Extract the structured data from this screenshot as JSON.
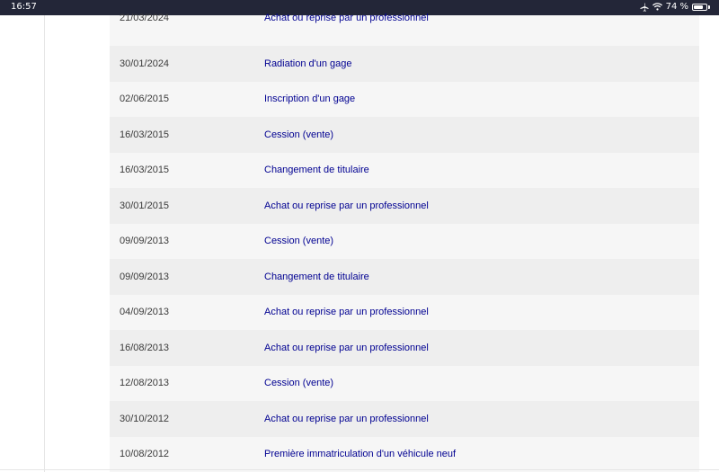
{
  "status_bar": {
    "time": "16:57",
    "battery": "74 %",
    "battery_level": 0.74,
    "icons": [
      "airplane-icon",
      "wifi-icon",
      "battery-icon"
    ]
  },
  "history": {
    "partial_row": {
      "date": "21/03/2024",
      "operation": "Achat ou reprise par un professionnel"
    },
    "rows": [
      {
        "date": "30/01/2024",
        "operation": "Radiation d'un gage"
      },
      {
        "date": "02/06/2015",
        "operation": "Inscription d'un gage"
      },
      {
        "date": "16/03/2015",
        "operation": "Cession (vente)"
      },
      {
        "date": "16/03/2015",
        "operation": "Changement de titulaire"
      },
      {
        "date": "30/01/2015",
        "operation": "Achat ou reprise par un professionnel"
      },
      {
        "date": "09/09/2013",
        "operation": "Cession (vente)"
      },
      {
        "date": "09/09/2013",
        "operation": "Changement de titulaire"
      },
      {
        "date": "04/09/2013",
        "operation": "Achat ou reprise par un professionnel"
      },
      {
        "date": "16/08/2013",
        "operation": "Achat ou reprise par un professionnel"
      },
      {
        "date": "12/08/2013",
        "operation": "Cession (vente)"
      },
      {
        "date": "30/10/2012",
        "operation": "Achat ou reprise par un professionnel"
      },
      {
        "date": "10/08/2012",
        "operation": "Première immatriculation d'un véhicule neuf"
      }
    ]
  },
  "colors": {
    "status_bar_bg": "#232638",
    "row_shade_a": "#eeeeee",
    "row_shade_b": "#f6f6f6",
    "operation_text": "#000091",
    "date_text": "#3a3a3a"
  }
}
